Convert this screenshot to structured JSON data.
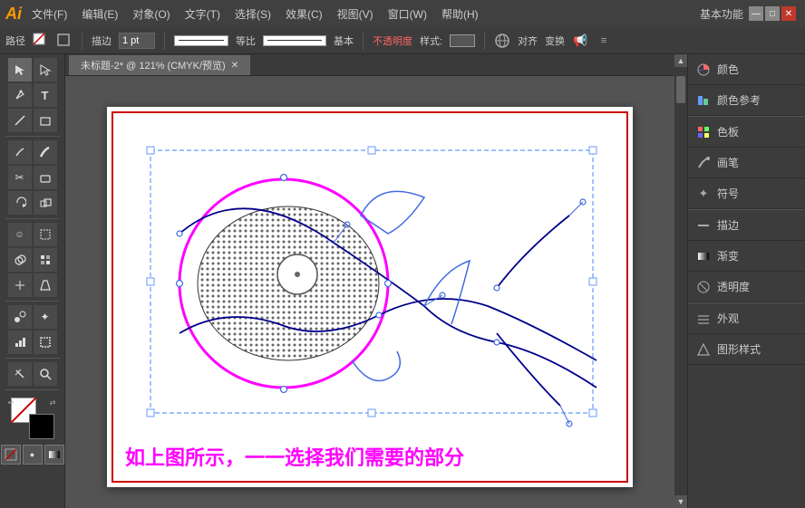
{
  "titlebar": {
    "logo": "Ai",
    "menus": [
      "文件(F)",
      "编辑(E)",
      "对象(O)",
      "文字(T)",
      "选择(S)",
      "效果(C)",
      "视图(V)",
      "窗口(W)",
      "帮助(H)"
    ],
    "workspace": "基本功能",
    "win_buttons": [
      "—",
      "□",
      "✕"
    ]
  },
  "optionsbar": {
    "path_label": "路径",
    "stroke_label": "描边",
    "stroke_size": "1 pt",
    "ratio_label": "等比",
    "basic_label": "基本",
    "opacity_label": "不透明度",
    "style_label": "样式:",
    "align_label": "对齐",
    "transform_label": "变换"
  },
  "tab": {
    "label": "未标题-2* @ 121% (CMYK/预览)",
    "close": "✕"
  },
  "canvas": {
    "caption": "如上图所示，一一选择我们需要的部分"
  },
  "toolbar": {
    "tools": [
      {
        "icon": "▲",
        "name": "selection-tool"
      },
      {
        "icon": "◈",
        "name": "direct-selection-tool"
      },
      {
        "icon": "✏",
        "name": "pen-tool"
      },
      {
        "icon": "T",
        "name": "type-tool"
      },
      {
        "icon": "╲",
        "name": "line-tool"
      },
      {
        "icon": "▭",
        "name": "shape-tool"
      },
      {
        "icon": "✎",
        "name": "pencil-tool"
      },
      {
        "icon": "≋",
        "name": "blob-brush"
      },
      {
        "icon": "✂",
        "name": "scissors-tool"
      },
      {
        "icon": "⟲",
        "name": "rotate-tool"
      },
      {
        "icon": "↔",
        "name": "scale-tool"
      },
      {
        "icon": "☞",
        "name": "puppet-warp"
      },
      {
        "icon": "✱",
        "name": "free-transform"
      },
      {
        "icon": "⬡",
        "name": "shape-builder"
      },
      {
        "icon": "⊕",
        "name": "live-paint"
      },
      {
        "icon": "⊞",
        "name": "grid-tool"
      },
      {
        "icon": "⬮",
        "name": "gradient-mesh"
      },
      {
        "icon": "⌀",
        "name": "perspective"
      },
      {
        "icon": "◑",
        "name": "blend-tool"
      },
      {
        "icon": "⬤",
        "name": "symbol"
      },
      {
        "icon": "⊿",
        "name": "column-graph"
      },
      {
        "icon": "✋",
        "name": "artboard-tool"
      },
      {
        "icon": "⊙",
        "name": "slice-tool"
      },
      {
        "icon": "✥",
        "name": "zoom-tool"
      }
    ]
  },
  "right_panel": {
    "items": [
      {
        "icon": "◐",
        "label": "颜色"
      },
      {
        "icon": "⊟",
        "label": "颜色参考"
      },
      {
        "icon": "▦",
        "label": "色板"
      },
      {
        "icon": "✏",
        "label": "画笔"
      },
      {
        "icon": "✦",
        "label": "符号"
      },
      {
        "icon": "—",
        "label": "描边"
      },
      {
        "icon": "▓",
        "label": "渐变"
      },
      {
        "icon": "◎",
        "label": "透明度"
      },
      {
        "icon": "☰",
        "label": "外观"
      },
      {
        "icon": "⬡",
        "label": "图形样式"
      }
    ]
  },
  "colors": {
    "magenta": "#ff00ff",
    "blue_path": "#4169e1",
    "dark_navy": "#00008b",
    "selection_blue": "#6699ff",
    "dotted_fill": "#888888"
  }
}
